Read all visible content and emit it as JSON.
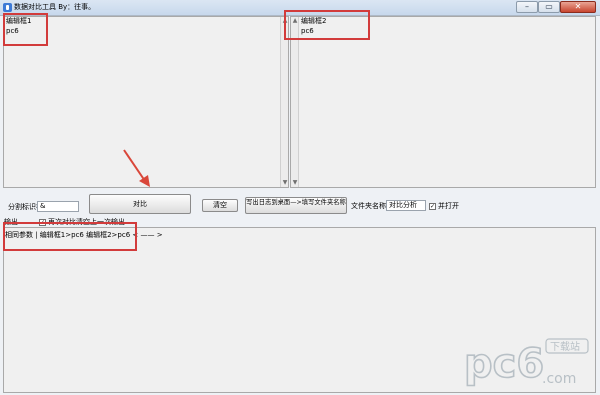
{
  "window": {
    "title": "数据对比工具  By：往事。",
    "min_label": "–",
    "max_label": "▭",
    "close_label": "✕"
  },
  "pane_left": {
    "label": "编辑框1",
    "content": "pc6"
  },
  "pane_right": {
    "label": "编辑框2",
    "content": "pc6"
  },
  "controls": {
    "delimiter_label": "分割标识符",
    "delimiter_value": "&",
    "compare_button": "对比",
    "clear_button": "清空",
    "write_log_button_line1": "写出日志到桌面",
    "write_log_button_line2": "—>填写文件夹名称",
    "folder_label": "文件夹名称",
    "folder_value": "对比分析",
    "open_checkbox_label": "并打开",
    "open_checked": true,
    "output_label": "输出",
    "clear_checkbox_label": "再次对比清空上一次输出",
    "clear_checked": true
  },
  "output": {
    "line": "相同参数 | 编辑框1>pc6         编辑框2>pc6  < —— >"
  },
  "watermark": {
    "text": "pc6",
    "subtitle": "下载站",
    "domain": ".com"
  },
  "colors": {
    "annotation": "#d23b3b",
    "arrow": "#d9473a"
  }
}
